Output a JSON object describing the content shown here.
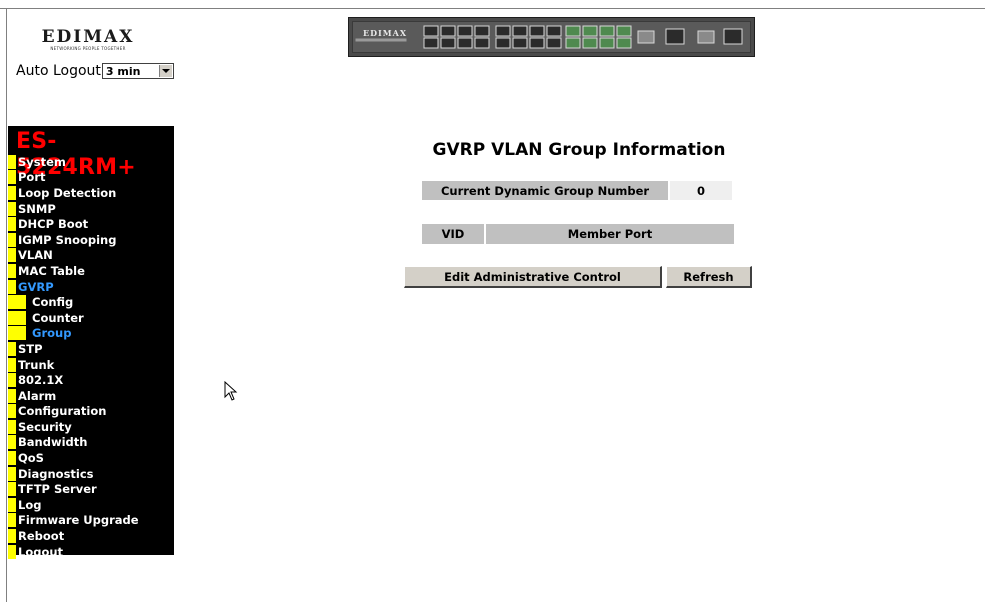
{
  "logo": {
    "brand": "EDIMAX",
    "tagline": "NETWORKING PEOPLE TOGETHER"
  },
  "auto_logout": {
    "label": "Auto Logout",
    "selected": "3 min"
  },
  "device": {
    "brand": "EDIMAX"
  },
  "sidebar": {
    "model": "ES-5224RM+",
    "items": [
      {
        "label": "System",
        "level": 0,
        "active": false
      },
      {
        "label": "Port",
        "level": 0,
        "active": false
      },
      {
        "label": "Loop Detection",
        "level": 0,
        "active": false
      },
      {
        "label": "SNMP",
        "level": 0,
        "active": false
      },
      {
        "label": "DHCP Boot",
        "level": 0,
        "active": false
      },
      {
        "label": "IGMP Snooping",
        "level": 0,
        "active": false
      },
      {
        "label": "VLAN",
        "level": 0,
        "active": false
      },
      {
        "label": "MAC Table",
        "level": 0,
        "active": false
      },
      {
        "label": "GVRP",
        "level": 0,
        "active": true
      },
      {
        "label": "Config",
        "level": 1,
        "active": false
      },
      {
        "label": "Counter",
        "level": 1,
        "active": false
      },
      {
        "label": "Group",
        "level": 1,
        "active": true
      },
      {
        "label": "STP",
        "level": 0,
        "active": false
      },
      {
        "label": "Trunk",
        "level": 0,
        "active": false
      },
      {
        "label": "802.1X",
        "level": 0,
        "active": false
      },
      {
        "label": "Alarm",
        "level": 0,
        "active": false
      },
      {
        "label": "Configuration",
        "level": 0,
        "active": false
      },
      {
        "label": "Security",
        "level": 0,
        "active": false
      },
      {
        "label": "Bandwidth",
        "level": 0,
        "active": false
      },
      {
        "label": "QoS",
        "level": 0,
        "active": false
      },
      {
        "label": "Diagnostics",
        "level": 0,
        "active": false
      },
      {
        "label": "TFTP Server",
        "level": 0,
        "active": false
      },
      {
        "label": "Log",
        "level": 0,
        "active": false
      },
      {
        "label": "Firmware Upgrade",
        "level": 0,
        "active": false
      },
      {
        "label": "Reboot",
        "level": 0,
        "active": false
      },
      {
        "label": "Logout",
        "level": 0,
        "active": false
      }
    ],
    "colors": {
      "background": "#000000",
      "marker": "#ffff00",
      "text": "#ffffff",
      "active_text": "#3399ff",
      "model": "#ff0000"
    }
  },
  "main": {
    "title": "GVRP VLAN Group Information",
    "current_dynamic_group": {
      "label": "Current Dynamic Group Number",
      "value": "0"
    },
    "table": {
      "columns": [
        "VID",
        "Member Port"
      ],
      "rows": []
    },
    "buttons": {
      "edit": "Edit Administrative Control",
      "refresh": "Refresh"
    }
  }
}
